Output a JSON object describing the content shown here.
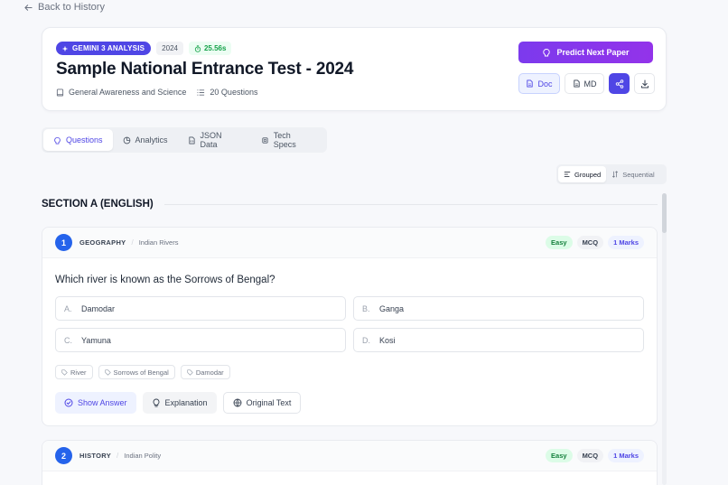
{
  "nav": {
    "back_label": "Back to History"
  },
  "header": {
    "badge_model": "GEMINI 3 ANALYSIS",
    "badge_year": "2024",
    "badge_time": "25.56s",
    "title": "Sample National Entrance Test - 2024",
    "subject": "General Awareness and Science",
    "question_count": "20 Questions",
    "predict_label": "Predict Next Paper",
    "doc_label": "Doc",
    "md_label": "MD"
  },
  "tabs": [
    {
      "label": "Questions",
      "active": true
    },
    {
      "label": "Analytics",
      "active": false
    },
    {
      "label": "JSON Data",
      "active": false
    },
    {
      "label": "Tech Specs",
      "active": false
    }
  ],
  "view_toggle": {
    "grouped": "Grouped",
    "sequential": "Sequential",
    "active": "Grouped"
  },
  "section": {
    "title": "SECTION A (ENGLISH)"
  },
  "questions": [
    {
      "number": "1",
      "subject": "GEOGRAPHY",
      "topic": "Indian Rivers",
      "difficulty": "Easy",
      "type": "MCQ",
      "marks": "1 Marks",
      "text": "Which river is known as the Sorrows of Bengal?",
      "options": [
        {
          "letter": "A.",
          "text": "Damodar"
        },
        {
          "letter": "B.",
          "text": "Ganga"
        },
        {
          "letter": "C.",
          "text": "Yamuna"
        },
        {
          "letter": "D.",
          "text": "Kosi"
        }
      ],
      "keywords": [
        "River",
        "Sorrows of Bengal",
        "Damodar"
      ],
      "actions": {
        "show_answer": "Show Answer",
        "explanation": "Explanation",
        "original_text": "Original Text"
      }
    },
    {
      "number": "2",
      "subject": "HISTORY",
      "topic": "Indian Polity",
      "difficulty": "Easy",
      "type": "MCQ",
      "marks": "1 Marks"
    }
  ],
  "colors": {
    "accent": "#4f46e5",
    "predict_gradient_start": "#7c3aed",
    "easy": "#15803d",
    "question_number": "#2563eb"
  }
}
